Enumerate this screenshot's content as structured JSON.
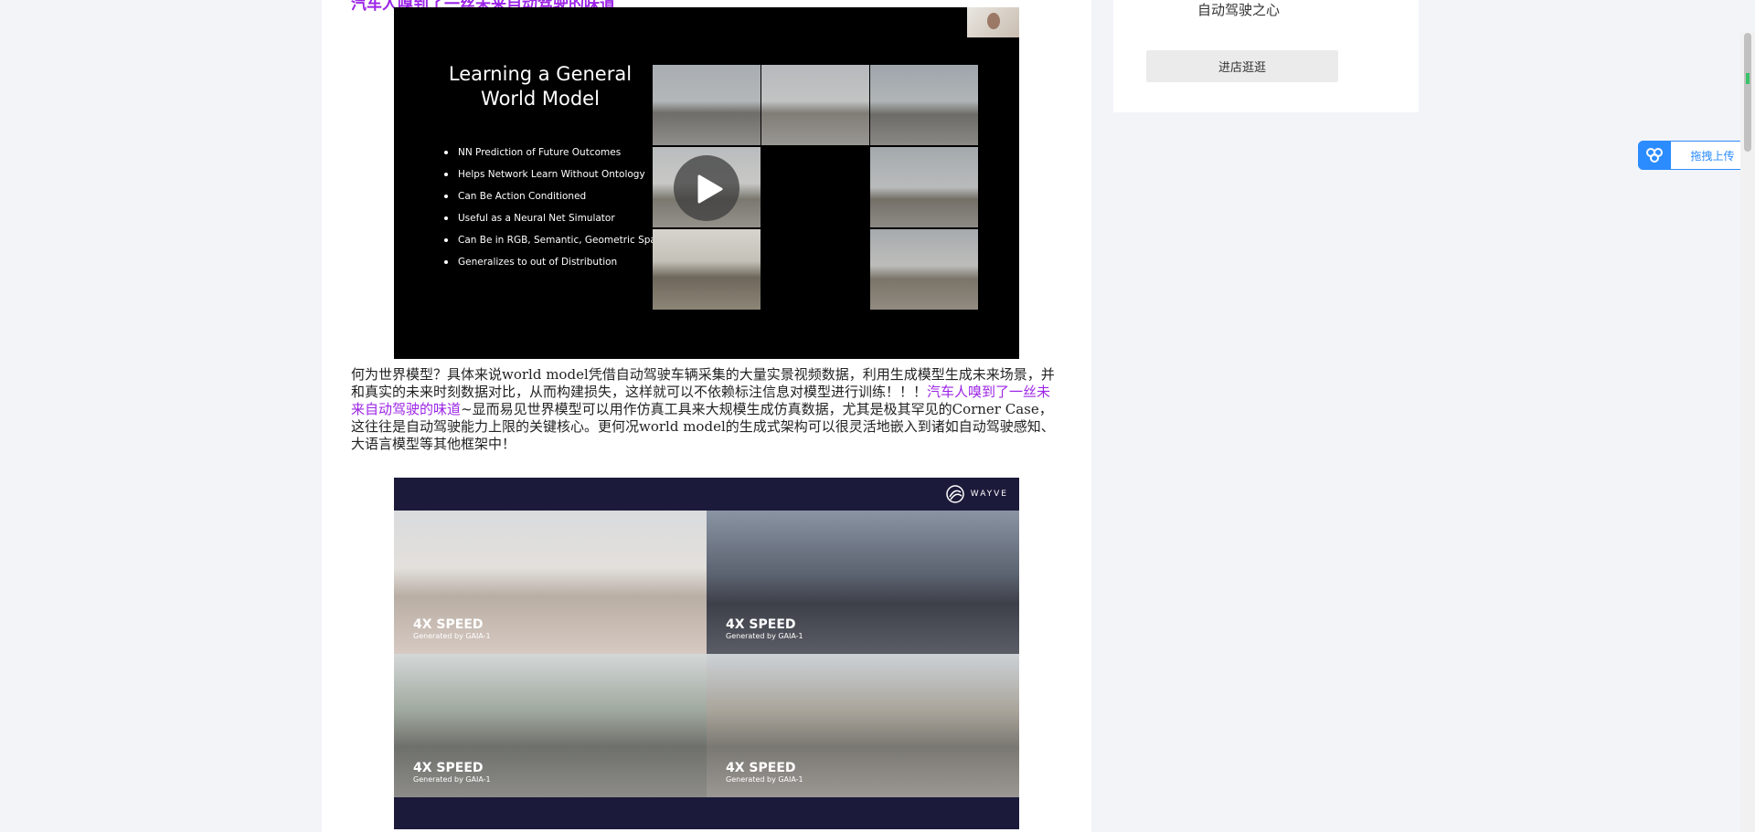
{
  "article": {
    "top_link_text": "汽车人嗅到了一丝未来自动驾驶的味道",
    "video": {
      "title_line1": "Learning a General",
      "title_line2": "World Model",
      "bullets": [
        "NN Prediction of Future Outcomes",
        "Helps Network Learn Without Ontology",
        "Can Be Action Conditioned",
        "Useful as a Neural Net Simulator",
        "Can Be in RGB, Semantic, Geometric Spaces",
        "Generalizes to out of Distribution"
      ],
      "play_icon": "play-icon"
    },
    "paragraph": {
      "part1": "何为世界模型？具体来说world model凭借自动驾驶车辆采集的大量实景视频数据，利用生成模型生成未来场景，并和真实的未来时刻数据对比，从而构建损失，这样就可以不依赖标注信息对模型进行训练！！！",
      "highlight": "汽车人嗅到了一丝未来自动驾驶的味道",
      "part2": "~显而易见世界模型可以用作仿真工具来大规模生成仿真数据，尤其是极其罕见的Corner Case，这往往是自动驾驶能力上限的关键核心。更何况world model的生成式架构可以很灵活地嵌入到诸如自动驾驶感知、大语言模型等其他框架中！"
    },
    "wayve_image": {
      "logo_text": "WAYVE",
      "frames": [
        {
          "speed": "4X SPEED",
          "caption": "Generated by GAIA-1"
        },
        {
          "speed": "4X SPEED",
          "caption": "Generated by GAIA-1"
        },
        {
          "speed": "4X SPEED",
          "caption": "Generated by GAIA-1"
        },
        {
          "speed": "4X SPEED",
          "caption": "Generated by GAIA-1"
        }
      ]
    }
  },
  "sidebar": {
    "shop_name": "自动驾驶之心",
    "shop_button_label": "进店逛逛"
  },
  "upload_widget": {
    "label": "拖拽上传",
    "icon": "baidu-netdisk-icon",
    "color": "#2b8cff"
  },
  "colors": {
    "highlight": "#9c25e6",
    "page_bg": "#f2f4f8"
  }
}
